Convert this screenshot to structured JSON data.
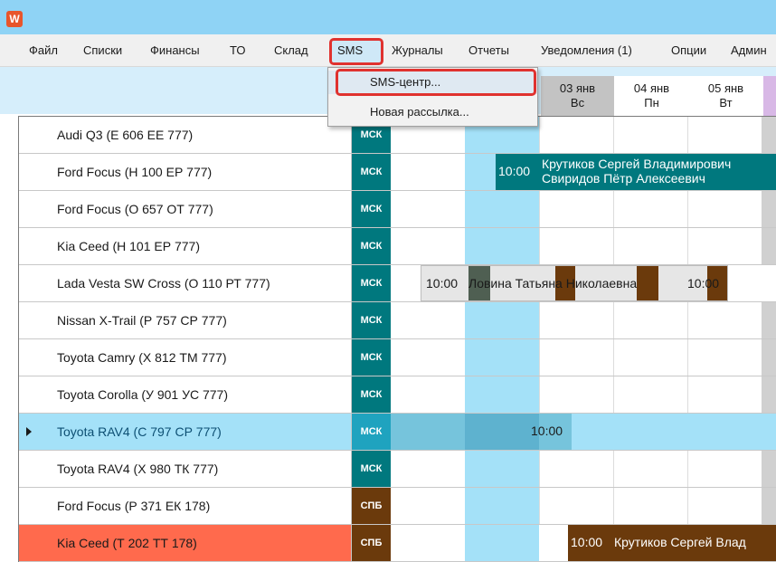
{
  "app": {
    "icon_label": "W"
  },
  "menu": {
    "items": [
      "Файл",
      "Списки",
      "Финансы",
      "ТО",
      "Склад",
      "SMS",
      "Журналы",
      "Отчеты",
      "Уведомления (1)",
      "Опции",
      "Админ"
    ],
    "open": "SMS",
    "dropdown": [
      "SMS-центр...",
      "Новая рассылка..."
    ]
  },
  "days": [
    {
      "date": "03 янв",
      "dow": "Вс"
    },
    {
      "date": "04 янв",
      "dow": "Пн"
    },
    {
      "date": "05 янв",
      "dow": "Вт"
    }
  ],
  "rows": [
    {
      "name": "Audi Q3 (Е 606 ЕЕ 777)",
      "city": "МСК"
    },
    {
      "name": "Ford Focus (Н 100 ЕР 777)",
      "city": "МСК"
    },
    {
      "name": "Ford Focus (О 657 ОТ 777)",
      "city": "МСК"
    },
    {
      "name": "Kia Ceed (Н 101 ЕР 777)",
      "city": "МСК"
    },
    {
      "name": "Lada Vesta SW Cross (О 110 РТ 777)",
      "city": "МСК"
    },
    {
      "name": "Nissan X-Trail (Р 757 СР 777)",
      "city": "МСК"
    },
    {
      "name": "Toyota Camry (Х 812 ТМ 777)",
      "city": "МСК"
    },
    {
      "name": "Toyota Corolla (У 901 УС 777)",
      "city": "МСК"
    },
    {
      "name": "Toyota RAV4 (С 797 СР 777)",
      "city": "МСК"
    },
    {
      "name": "Toyota RAV4 (Х 980 ТК 777)",
      "city": "МСК"
    },
    {
      "name": "Ford Focus (Р 371 ЕК 178)",
      "city": "СПБ"
    },
    {
      "name": "Kia Ceed (Т 202 ТТ 178)",
      "city": "СПБ"
    }
  ],
  "events": {
    "ford_focus_h100": {
      "time": "10:00",
      "line1": "Крутиков Сергей Владимирович",
      "line2": "Свиридов Пётр Алексеевич"
    },
    "lada_vesta": {
      "time_start": "10:00",
      "client": "Ловина Татьяна Николаевна",
      "time_end": "10:00"
    },
    "toyota_rav4_c797": {
      "time": "10:00"
    },
    "kia_ceed_t202": {
      "time": "10:00",
      "client": "Крутиков Сергей Влад"
    }
  },
  "colors": {
    "titlebar": "#8fd3f5",
    "highlight_red": "#e0322f",
    "msk": "#00787e",
    "spb": "#6b3a0c",
    "today_column": "#a4e1f8",
    "selected_row": "#a4e1f8",
    "alert_row": "#ff6a4d",
    "event_teal": "#00787e",
    "event_brown": "#6b3a0c"
  }
}
